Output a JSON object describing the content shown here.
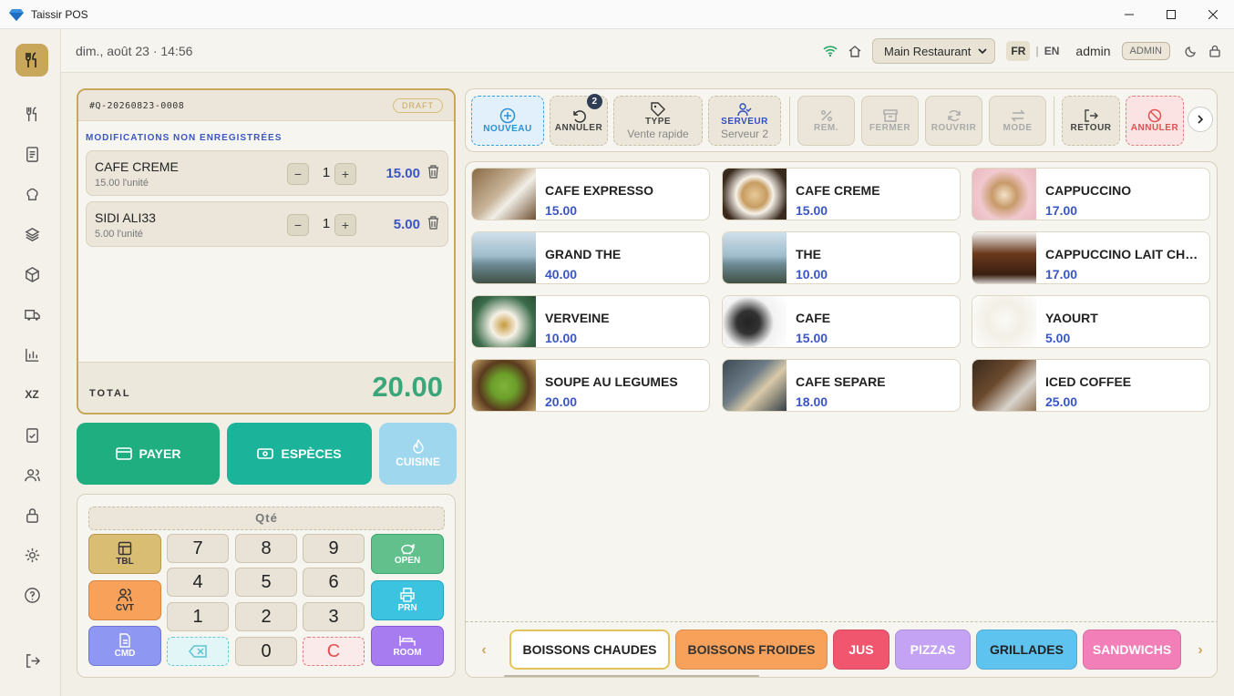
{
  "window": {
    "title": "Taissir POS"
  },
  "topbar": {
    "datetime": "dim., août 23 · 14:56",
    "restaurant": "Main Restaurant",
    "lang_fr": "FR",
    "lang_en": "EN",
    "user": "admin",
    "role": "ADMIN"
  },
  "order": {
    "number": "#Q-20260823-0008",
    "status": "DRAFT",
    "unsaved": "MODIFICATIONS NON ENREGISTRÉES",
    "items": [
      {
        "name": "CAFE CREME",
        "unit": "15.00 l'unité",
        "qty": "1",
        "price": "15.00"
      },
      {
        "name": "SIDI ALI33",
        "unit": "5.00 l'unité",
        "qty": "1",
        "price": "5.00"
      }
    ],
    "total_label": "TOTAL",
    "total": "20.00"
  },
  "buttons": {
    "pay": "PAYER",
    "cash": "ESPÈCES",
    "kitchen": "CUISINE"
  },
  "keypad": {
    "qty_label": "Qté",
    "digits": [
      "7",
      "8",
      "9",
      "4",
      "5",
      "6",
      "1",
      "2",
      "3",
      "0"
    ],
    "clear": "C",
    "tbl": "TBL",
    "cvt": "CVT",
    "cmd": "CMD",
    "open": "OPEN",
    "prn": "PRN",
    "room": "ROOM"
  },
  "actions": {
    "new": "NOUVEAU",
    "undo": "ANNULER",
    "undo_badge": "2",
    "type_label": "TYPE",
    "type_value": "Vente rapide",
    "server_label": "SERVEUR",
    "server_value": "Serveur 2",
    "discount": "REM.",
    "close": "FERMER",
    "reopen": "ROUVRIR",
    "mode": "MODE",
    "return": "RETOUR",
    "cancel": "ANNULER"
  },
  "products": [
    {
      "name": "CAFE EXPRESSO",
      "price": "15.00"
    },
    {
      "name": "CAFE CREME",
      "price": "15.00"
    },
    {
      "name": "CAPPUCCINO",
      "price": "17.00"
    },
    {
      "name": "GRAND THE",
      "price": "40.00"
    },
    {
      "name": "THE",
      "price": "10.00"
    },
    {
      "name": "CAPPUCCINO LAIT CHOCOLAT",
      "price": "17.00"
    },
    {
      "name": "VERVEINE",
      "price": "10.00"
    },
    {
      "name": "CAFE",
      "price": "15.00"
    },
    {
      "name": "YAOURT",
      "price": "5.00"
    },
    {
      "name": "SOUPE AU LEGUMES",
      "price": "20.00"
    },
    {
      "name": "CAFE SEPARE",
      "price": "18.00"
    },
    {
      "name": "ICED COFFEE",
      "price": "25.00"
    }
  ],
  "categories": [
    {
      "name": "BOISSONS CHAUDES",
      "color": "#ffffff"
    },
    {
      "name": "BOISSONS FROIDES",
      "color": "#f7a15a"
    },
    {
      "name": "JUS",
      "color": "#f0566e"
    },
    {
      "name": "PIZZAS",
      "color": "#c4a3f5"
    },
    {
      "name": "GRILLADES",
      "color": "#5fc3ef"
    },
    {
      "name": "SANDWICHS",
      "color": "#f27fb8"
    }
  ],
  "colors": {
    "accent": "#c8a75a",
    "price": "#3a56c4",
    "total": "#3aa77a",
    "pay": "#1fae7f",
    "cash": "#1bb39a"
  }
}
